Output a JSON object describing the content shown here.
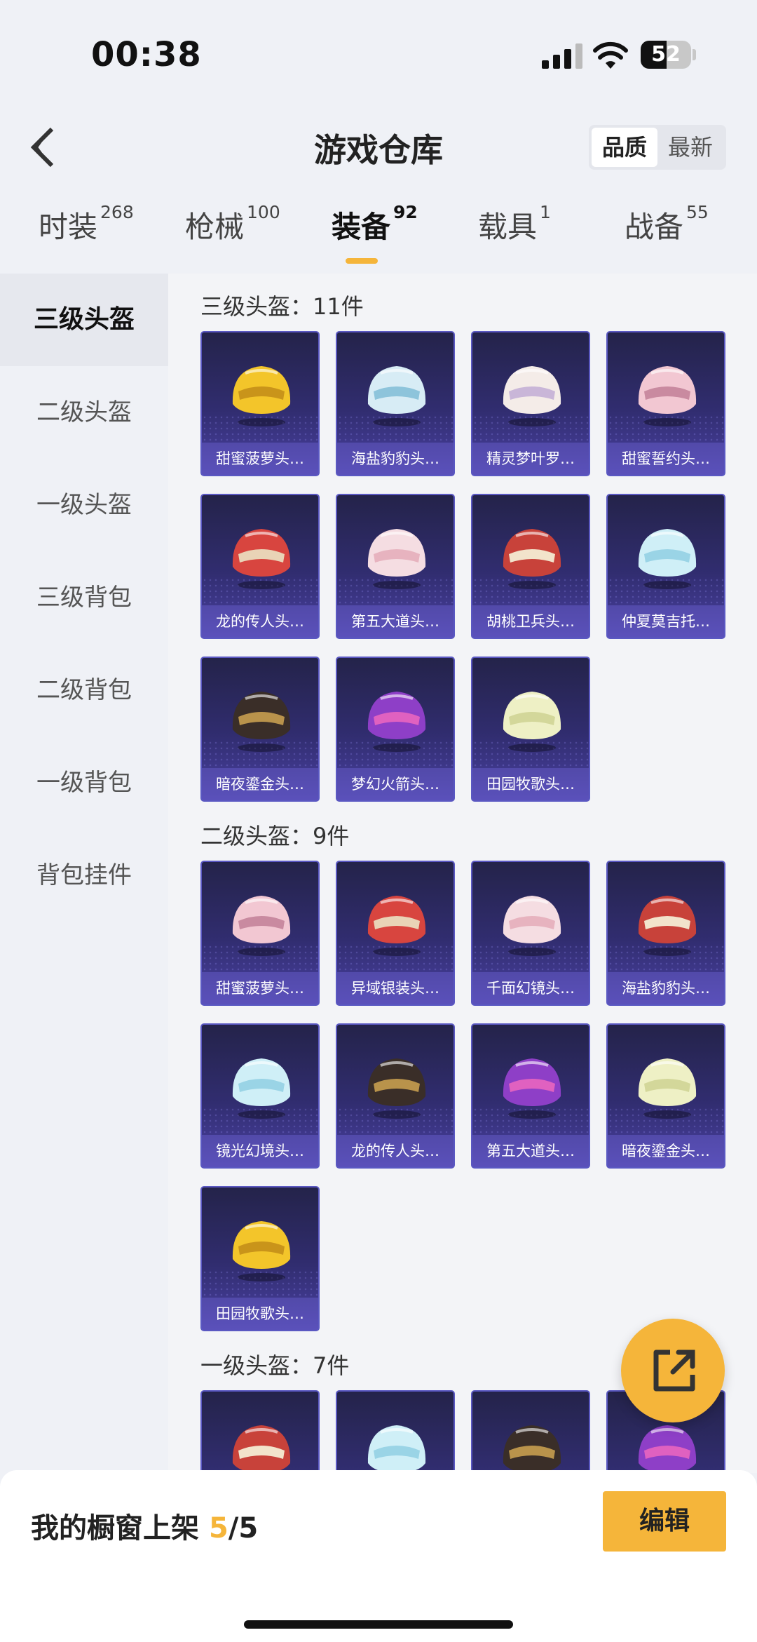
{
  "status": {
    "time": "00:38",
    "battery": "52"
  },
  "header": {
    "title": "游戏仓库",
    "sort_quality": "品质",
    "sort_newest": "最新"
  },
  "tabs": [
    {
      "label": "时装",
      "count": "268"
    },
    {
      "label": "枪械",
      "count": "100"
    },
    {
      "label": "装备",
      "count": "92"
    },
    {
      "label": "载具",
      "count": "1"
    },
    {
      "label": "战备",
      "count": "55"
    }
  ],
  "sidebar": [
    "三级头盔",
    "二级头盔",
    "一级头盔",
    "三级背包",
    "二级背包",
    "一级背包",
    "背包挂件"
  ],
  "sections": [
    {
      "title": "三级头盔：11件",
      "items": [
        "甜蜜菠萝头…",
        "海盐豹豹头…",
        "精灵梦叶罗…",
        "甜蜜誓约头…",
        "龙的传人头…",
        "第五大道头…",
        "胡桃卫兵头…",
        "仲夏莫吉托…",
        "暗夜鎏金头…",
        "梦幻火箭头…",
        "田园牧歌头…"
      ]
    },
    {
      "title": "二级头盔：9件",
      "items": [
        "甜蜜菠萝头…",
        "异域银装头…",
        "千面幻镜头…",
        "海盐豹豹头…",
        "镜光幻境头…",
        "龙的传人头…",
        "第五大道头…",
        "暗夜鎏金头…",
        "田园牧歌头…"
      ]
    },
    {
      "title": "一级头盔：7件",
      "items": [
        "",
        "",
        "",
        ""
      ]
    }
  ],
  "bottom": {
    "shelf_label": "我的橱窗上架",
    "shelf_count": "5",
    "shelf_total": "/5",
    "edit": "编辑"
  },
  "colors": {
    "accent": "#f5b53a",
    "card_bg": "#312d70"
  }
}
